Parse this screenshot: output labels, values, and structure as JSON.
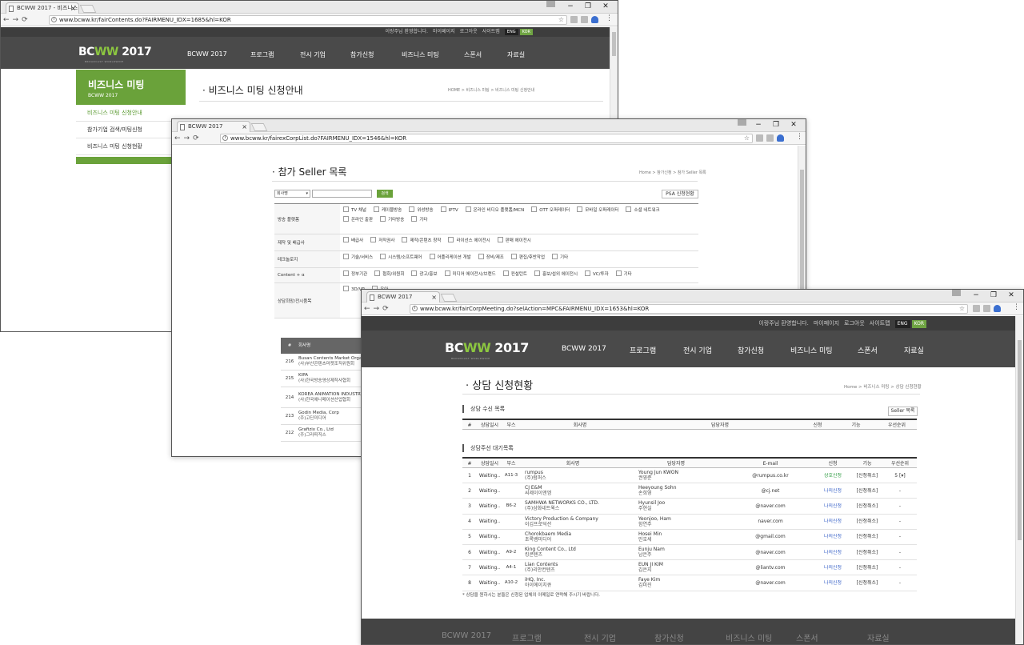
{
  "common": {
    "ctl_min": "−",
    "ctl_max": "❐",
    "ctl_close": "✕",
    "nav_back": "←",
    "nav_fwd": "→",
    "nav_reload": "⟳",
    "star": "☆",
    "menu": "⋮",
    "tab_close": "×",
    "top_greeting": "이랑주님 환영합니다.",
    "top_mypage": "마이페이지",
    "top_logout": "로그아웃",
    "top_sitemap": "사이트맵",
    "lang_en": "ENG",
    "lang_ko": "KOR",
    "logo_a": "BC",
    "logo_b": "WW",
    "logo_c": " 2017",
    "logo_tag": "BROADCAST WORLDWIDE",
    "nav": [
      "BCWW 2017",
      "프로그램",
      "전시 기업",
      "참가신청",
      "비즈니스 미팅",
      "스폰서",
      "자료실"
    ]
  },
  "win1": {
    "tab_title": "BCWW 2017 - 비즈니스 미",
    "url": "www.bcww.kr/fairContents.do?FAIRMENU_IDX=1685&hl=KOR",
    "side_title": "비즈니스 미팅",
    "side_sub": "BCWW 2017",
    "side_items": [
      "비즈니스 미팅 신청안내",
      "참가기업 검색/미팅신청",
      "비즈니스 미팅 신청현황"
    ],
    "page_title": "비즈니스 미팅 신청안내",
    "breadcrumb": "HOME > 비즈니스 미팅 > 비즈니스 미팅 신청안내"
  },
  "win2": {
    "tab_title": "BCWW 2017",
    "url": "www.bcww.kr/fairexCorpList.do?FAIRMENU_IDX=1546&hl=KOR",
    "page_title": "참가 Seller 목록",
    "breadcrumb": "Home > 참가신청 > 참가 Seller 목록",
    "select_value": "회사명",
    "search_btn": "검색",
    "psa_btn": "PSA 신청현황",
    "filters": [
      {
        "label": "방송 플랫폼",
        "items": [
          "TV 채널",
          "케이블방송",
          "위성방송",
          "IPTV",
          "온라인 비디오 플랫폼/MCN",
          "OTT 오퍼레이터",
          "모바일 오퍼레이터",
          "소셜 네트워크",
          "온라인 출판",
          "기타방송",
          "기타"
        ]
      },
      {
        "label": "제작 및 배급사",
        "items": [
          "배급사",
          "저작권사",
          "제작/콘텐츠 창작",
          "라이선스 에이전시",
          "판매 에이전시"
        ]
      },
      {
        "label": "테크놀로지",
        "items": [
          "기술/서비스",
          "시스템/소프트웨어",
          "어플리케이션 개발",
          "장비/제조",
          "편집/후반작업",
          "기타"
        ]
      },
      {
        "label": "Content + α",
        "items": [
          "정부기관",
          "협회/위원회",
          "광고/홍보",
          "미디어 에이전시/브랜드",
          "컨설턴트",
          "홍보/섭외 에이전시",
          "VC/투자",
          "기타"
        ]
      },
      {
        "label": "상담희망/전시품목",
        "items": [
          "3D/VR",
          "유아"
        ]
      }
    ],
    "list_head": [
      "#",
      "회사명"
    ],
    "list_rows": [
      {
        "no": "216",
        "name": "Busan Contents Market Organizing Committee",
        "kname": "(사)부산콘텐츠마켓조직위원회"
      },
      {
        "no": "215",
        "name": "KIPA",
        "kname": "(사)한국방송영상제작사협회"
      },
      {
        "no": "214",
        "name": "KOREA ANIMATION INDUSTRY ASSOCIATION",
        "kname": "(사)한국애니메이션산업협회"
      },
      {
        "no": "213",
        "name": "Godin Media, Corp",
        "kname": "(주)고딘미디어"
      },
      {
        "no": "212",
        "name": "Grafizix Co., Ltd",
        "kname": "(주)그라피직스"
      }
    ]
  },
  "win3": {
    "tab_title": "BCWW 2017",
    "url": "www.bcww.kr/fairCorpMeeting.do?selAction=MPC&FAIRMENU_IDX=1653&hl=KOR",
    "page_title": "상담 신청현황",
    "breadcrumb": "Home > 비즈니스 미팅 > 상담 신청현황",
    "sec1": "상담 수신 목록",
    "seller_btn": "Seller 목록",
    "head1": [
      "#",
      "상담일시",
      "부스",
      "회사명",
      "담당자명",
      "신청",
      "기능",
      "우선순위"
    ],
    "sec2": "상담주선 대기목록",
    "head2": [
      "#",
      "상담일시",
      "부스",
      "회사명",
      "담당자명",
      "E-mail",
      "신청",
      "기능",
      "우선순위"
    ],
    "rows": [
      {
        "no": "1",
        "time": "Waiting..",
        "booth": "A11-3",
        "company": "rumpus",
        "kcompany": "(주)럼퍼스",
        "contact": "Young Jun KWON",
        "kcontact": "권영준",
        "email": "@rumpus.co.kr",
        "status": "상호신청",
        "action": "[신청취소]",
        "priority": "5 [▾]"
      },
      {
        "no": "2",
        "time": "Waiting..",
        "booth": "",
        "company": "CJ E&M",
        "kcompany": "씨제이이앤엠",
        "contact": "Heeyoung Sohn",
        "kcontact": "손희영",
        "email": "@cj.net",
        "status": "나의신청",
        "action": "[신청취소]",
        "priority": "-"
      },
      {
        "no": "3",
        "time": "Waiting..",
        "booth": "B6-2",
        "company": "SAMHWA NETWORKS CO., LTD.",
        "kcompany": "(주)삼화네트웍스",
        "contact": "Hyunsil Joo",
        "kcontact": "주현실",
        "email": "@naver.com",
        "status": "나의신청",
        "action": "[신청취소]",
        "priority": "-"
      },
      {
        "no": "4",
        "time": "Waiting..",
        "booth": "",
        "company": "Victory Production & Company",
        "kcompany": "이김프로덕션",
        "contact": "Yeonjoo, Ham",
        "kcontact": "함연주",
        "email": "naver.com",
        "status": "나의신청",
        "action": "[신청취소]",
        "priority": "-"
      },
      {
        "no": "5",
        "time": "Waiting..",
        "booth": "",
        "company": "Chorokbaem Media",
        "kcompany": "초록뱀미디어",
        "contact": "Hosei Min",
        "kcontact": "민호세",
        "email": "@gmail.com",
        "status": "나의신청",
        "action": "[신청취소]",
        "priority": "-"
      },
      {
        "no": "6",
        "time": "Waiting..",
        "booth": "A9-2",
        "company": "King Content Co., Ltd",
        "kcompany": "킹콘텐츠",
        "contact": "Eunju Nam",
        "kcontact": "남은주",
        "email": "@naver.com",
        "status": "나의신청",
        "action": "[신청취소]",
        "priority": "-"
      },
      {
        "no": "7",
        "time": "Waiting..",
        "booth": "A4-1",
        "company": "Lian Contents",
        "kcompany": "(주)리안컨텐츠",
        "contact": "EUN JI KIM",
        "kcontact": "김은지",
        "email": "@liantv.com",
        "status": "나의신청",
        "action": "[신청취소]",
        "priority": "-"
      },
      {
        "no": "8",
        "time": "Waiting..",
        "booth": "A10-2",
        "company": "iHQ, Inc.",
        "kcompany": "아이에이치큐",
        "contact": "Faye Kim",
        "kcontact": "김미진",
        "email": "@naver.com",
        "status": "나의신청",
        "action": "[신청취소]",
        "priority": "-"
      }
    ],
    "note": "* 상담을 원하시는 분들은 신청된 업체의 이메일로 연락해 주시기 바랍니다."
  }
}
